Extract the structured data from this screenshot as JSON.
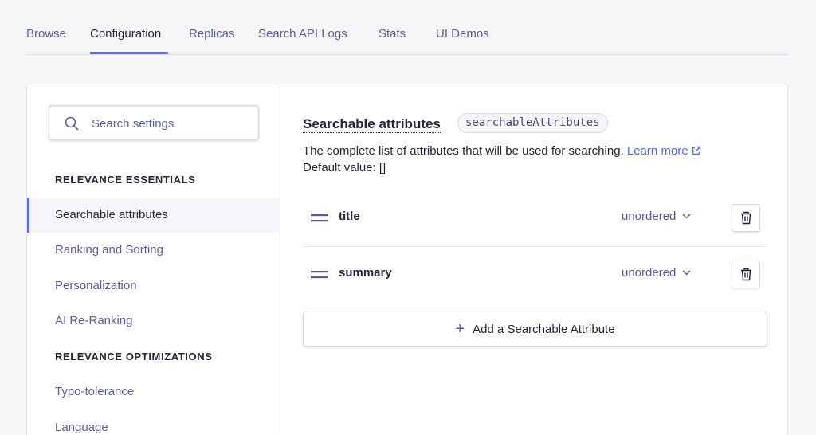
{
  "tabs": [
    "Browse",
    "Configuration",
    "Replicas",
    "Search API Logs",
    "Stats",
    "UI Demos"
  ],
  "active_tab": "Configuration",
  "sidebar": {
    "search_placeholder": "Search settings",
    "section_essentials": "RELEVANCE ESSENTIALS",
    "essentials_items": [
      "Searchable attributes",
      "Ranking and Sorting",
      "Personalization",
      "AI Re-Ranking"
    ],
    "section_optimizations": "RELEVANCE OPTIMIZATIONS",
    "optimizations_items": [
      "Typo-tolerance",
      "Language"
    ],
    "active_item": "Searchable attributes"
  },
  "main": {
    "title": "Searchable attributes",
    "code_badge": "searchableAttributes",
    "description": "The complete list of attributes that will be used for searching.",
    "learn_more": "Learn more",
    "default_value": "Default value: []",
    "attributes": [
      {
        "name": "title",
        "order": "unordered"
      },
      {
        "name": "summary",
        "order": "unordered"
      }
    ],
    "add_button": "Add a Searchable Attribute"
  },
  "colors": {
    "accent": "#5468ff",
    "text": "#23263b",
    "muted": "#5a5e9a",
    "drag_icon": "#5a5e9a"
  },
  "icons": [
    "search-icon",
    "external-link-icon",
    "drag-handle-icon",
    "chevron-down-icon",
    "trash-icon",
    "plus-icon"
  ]
}
